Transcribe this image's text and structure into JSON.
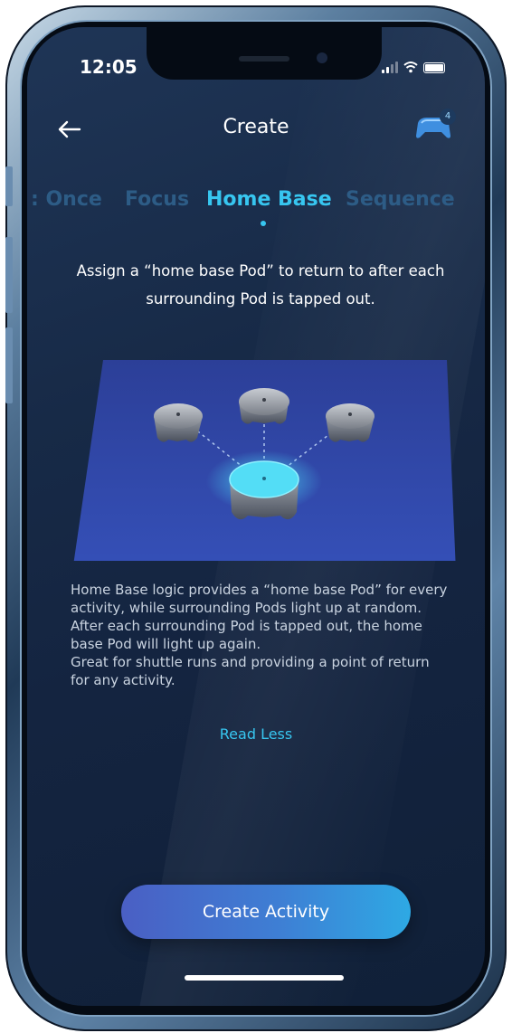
{
  "status_bar": {
    "time": "12:05"
  },
  "header": {
    "title": "Create",
    "controller_badge": "4"
  },
  "tabs": [
    {
      "label": "Once",
      "partial_prefix": ":",
      "active": false
    },
    {
      "label": "Focus",
      "active": false
    },
    {
      "label": "Home Base",
      "active": true
    },
    {
      "label": "Sequence",
      "active": false
    }
  ],
  "intro": "Assign a “home base Pod” to return to after each surrounding Pod is tapped out.",
  "description": [
    "Home Base logic provides a “home base Pod” for every activity, while surrounding Pods light up at random.",
    "After each surrounding Pod is tapped out, the home base Pod will light up again.",
    "Great for shuttle runs and providing a point of return for any activity."
  ],
  "read_less": "Read Less",
  "primary_button": "Create Activity",
  "colors": {
    "accent": "#37c6f0",
    "inactive_tab": "#2d5c86",
    "background": "#172a47",
    "button_gradient": [
      "#4a5fc4",
      "#2ea9e4"
    ]
  },
  "icons": {
    "back": "arrow-left-icon",
    "controller": "controller-icon",
    "signal": "signal-icon",
    "wifi": "wifi-icon",
    "battery": "battery-icon"
  }
}
